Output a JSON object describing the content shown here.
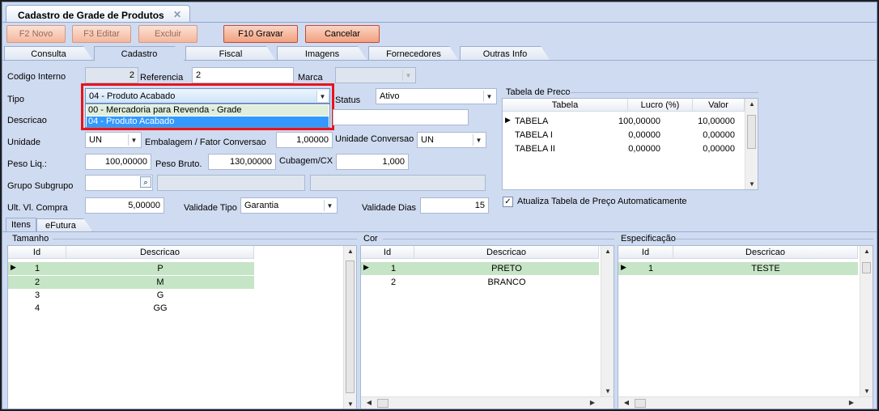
{
  "window": {
    "doc_tab_title": "Cadastro de Grade de Produtos",
    "close_glyph": "✕"
  },
  "toolbar": {
    "novo": "F2 Novo",
    "editar": "F3 Editar",
    "excluir": "Excluir",
    "gravar": "F10 Gravar",
    "cancelar": "Cancelar"
  },
  "tabs": [
    "Consulta",
    "Cadastro",
    "Fiscal",
    "Imagens",
    "Fornecedores",
    "Outras Info"
  ],
  "form": {
    "codigo_interno_label": "Codigo Interno",
    "codigo_interno_value": "2",
    "referencia_label": "Referencia",
    "referencia_value": "2",
    "marca_label": "Marca",
    "marca_value": "",
    "tipo_label": "Tipo",
    "tipo_value": "04 - Produto Acabado",
    "tipo_options": [
      "00 - Mercadoria para Revenda - Grade",
      "04 - Produto Acabado"
    ],
    "status_label": "Status",
    "status_value": "Ativo",
    "descricao_label": "Descricao",
    "descricao_value": "",
    "unidade_label": "Unidade",
    "unidade_value": "UN",
    "embalagem_label": "Embalagem / Fator Conversao",
    "embalagem_value": "1,00000",
    "unidade_conversao_label": "Unidade Conversao",
    "unidade_conversao_value": "UN",
    "peso_liq_label": "Peso Liq.:",
    "peso_liq_value": "100,00000",
    "peso_bruto_label": "Peso Bruto.",
    "peso_bruto_value": "130,00000",
    "cubagem_label": "Cubagem/CX",
    "cubagem_value": "1,000",
    "grupo_label": "Grupo Subgrupo",
    "ult_vl_label": "Ult. Vl. Compra",
    "ult_vl_value": "5,00000",
    "validade_tipo_label": "Validade Tipo",
    "validade_tipo_value": "Garantia",
    "validade_dias_label": "Validade Dias",
    "validade_dias_value": "15"
  },
  "tabela_preco": {
    "title": "Tabela de Preco",
    "columns": [
      "Tabela",
      "Lucro (%)",
      "Valor"
    ],
    "rows": [
      {
        "tabela": "TABELA",
        "lucro": "100,00000",
        "valor": "10,00000"
      },
      {
        "tabela": "TABELA I",
        "lucro": "0,00000",
        "valor": "0,00000"
      },
      {
        "tabela": "TABELA II",
        "lucro": "0,00000",
        "valor": "0,00000"
      }
    ],
    "auto_label": "Atualiza Tabela de Preço Automaticamente",
    "auto_checked": true
  },
  "subtabs": [
    "Itens",
    "eFutura"
  ],
  "tamanho": {
    "title": "Tamanho",
    "columns": [
      "Id",
      "Descricao"
    ],
    "rows": [
      {
        "id": "1",
        "desc": "P"
      },
      {
        "id": "2",
        "desc": "M"
      },
      {
        "id": "3",
        "desc": "G"
      },
      {
        "id": "4",
        "desc": "GG"
      }
    ]
  },
  "cor": {
    "title": "Cor",
    "columns": [
      "Id",
      "Descricao"
    ],
    "rows": [
      {
        "id": "1",
        "desc": "PRETO"
      },
      {
        "id": "2",
        "desc": "BRANCO"
      }
    ]
  },
  "especificacao": {
    "title": "Especificação",
    "columns": [
      "Id",
      "Descricao"
    ],
    "rows": [
      {
        "id": "1",
        "desc": "TESTE"
      }
    ]
  },
  "colors": {
    "accent_red": "#e8141b",
    "selected_row": "#c6e4c6",
    "dropdown_highlight": "#3399ff",
    "background": "#cfdbf0"
  }
}
